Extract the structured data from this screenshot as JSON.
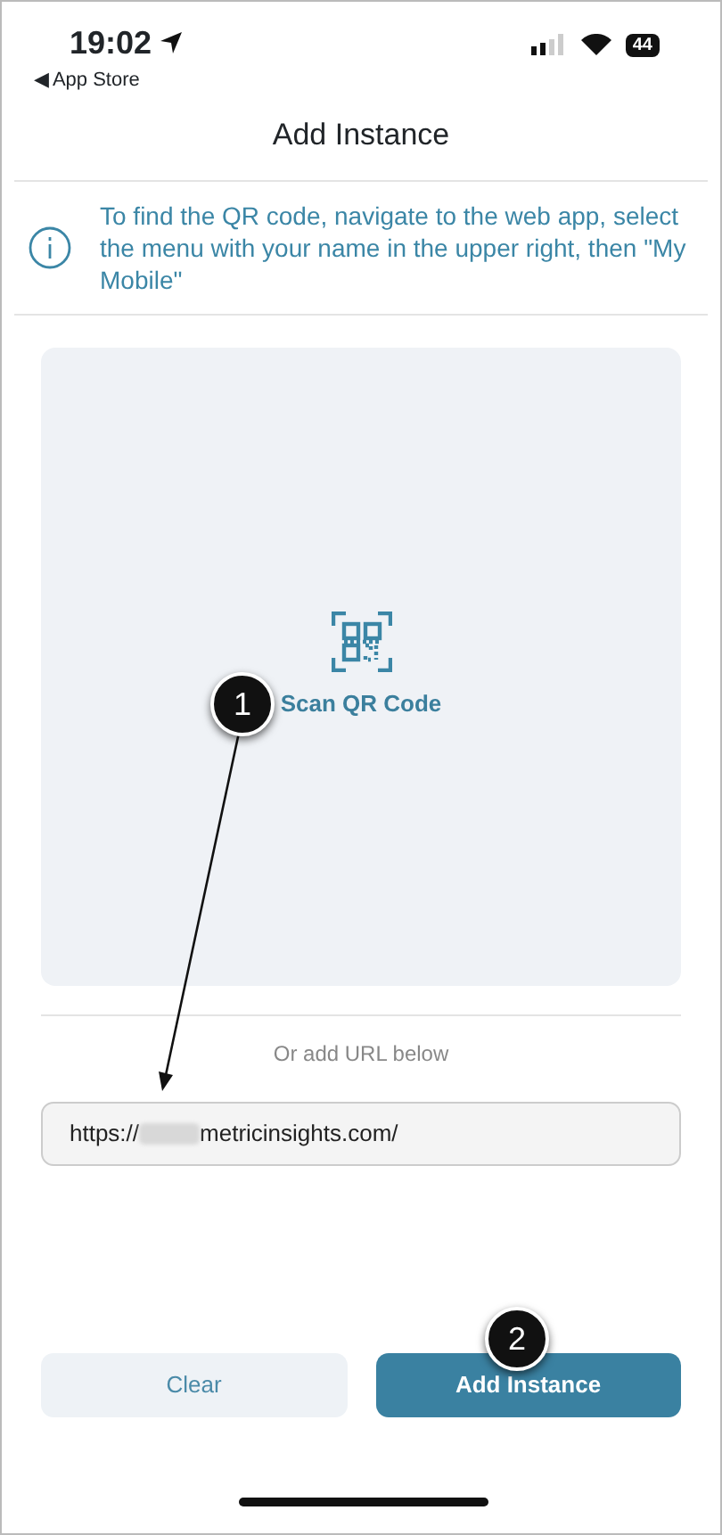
{
  "status_bar": {
    "time": "19:02",
    "back_label": "◀ App Store",
    "battery": "44"
  },
  "title": "Add Instance",
  "info": {
    "text": "To find the QR code, navigate to the web app, select the menu with your name in the upper right, then \"My Mobile\""
  },
  "scan": {
    "label": "Scan QR Code"
  },
  "divider_label": "Or add URL below",
  "url_field": {
    "value_start": "https://",
    "value_end": "metricinsights.com/",
    "redacted": true
  },
  "buttons": [
    {
      "label": "Clear",
      "kind": "secondary"
    },
    {
      "label": "Add Instance",
      "kind": "primary"
    }
  ],
  "callouts": [
    {
      "label": "1"
    },
    {
      "label": "2"
    }
  ]
}
